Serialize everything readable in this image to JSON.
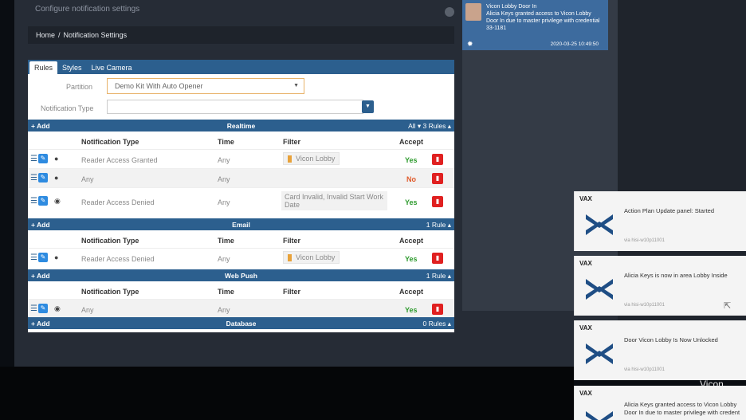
{
  "header": {
    "subtitle": "Configure notification settings",
    "breadcrumb_home": "Home",
    "breadcrumb_sep": "/",
    "breadcrumb_current": "Notification Settings"
  },
  "top_notification": {
    "title": "Vicon Lobby Door In",
    "body": "Alicia Keys granted access to Vicon Lobby Door In due to master privilege with credential 33-1181",
    "time": "2020-03-25 10:49:50"
  },
  "tabs": [
    "Rules",
    "Styles",
    "Live Camera"
  ],
  "form": {
    "partition_label": "Partition",
    "partition_value": "Demo Kit With Auto Opener",
    "type_label": "Notification Type",
    "type_value": ""
  },
  "columns": {
    "type": "Notification Type",
    "time": "Time",
    "filter": "Filter",
    "accept": "Accept"
  },
  "add_label": "+ Add",
  "sections": {
    "realtime": {
      "title": "Realtime",
      "count": "All ▾  3 Rules ▴",
      "rows": [
        {
          "type": "Reader Access Granted",
          "time": "Any",
          "filter": "Vicon Lobby",
          "accept": "Yes"
        },
        {
          "type": "Any",
          "time": "Any",
          "filter": "",
          "accept": "No"
        },
        {
          "type": "Reader Access Denied",
          "time": "Any",
          "filter": "Card Invalid, Invalid Start Work Date",
          "accept": "Yes"
        }
      ]
    },
    "email": {
      "title": "Email",
      "count": "1 Rule ▴",
      "rows": [
        {
          "type": "Reader Access Denied",
          "time": "Any",
          "filter": "Vicon Lobby",
          "accept": "Yes"
        }
      ]
    },
    "webpush": {
      "title": "Web Push",
      "count": "1 Rule ▴",
      "rows": [
        {
          "type": "Any",
          "time": "Any",
          "filter": "",
          "accept": "Yes"
        }
      ]
    },
    "database": {
      "title": "Database",
      "count": "0 Rules ▴"
    }
  },
  "toasts": [
    {
      "brand": "VAX",
      "message": "Action Plan Update panel: Started",
      "via": "via hisi-w10p11001"
    },
    {
      "brand": "VAX",
      "message": "Alicia  Keys is now in area Lobby Inside",
      "via": "via hisi-w10p11001"
    },
    {
      "brand": "VAX",
      "message": "Door Vicon Lobby Is Now Unlocked",
      "via": "via hisi-w10p11001"
    },
    {
      "brand": "VAX",
      "message": "Alicia  Keys granted access to Vicon Lobby Door In due to master privilege with credent",
      "via": ""
    }
  ],
  "watermark": "Vicon",
  "icons": {
    "list": "list-icon",
    "edit": "edit-icon",
    "user": "user-icon",
    "globe": "globe-icon",
    "delete": "trash-icon",
    "gear": "gear-icon"
  },
  "colors": {
    "header_blue": "#2c5f8e",
    "accept_yes": "#2e9b2e",
    "accept_no": "#e05a2a",
    "delete_red": "#e02020",
    "notif_blue": "#3d6b9e",
    "vax_logo": "#1f4e85"
  }
}
